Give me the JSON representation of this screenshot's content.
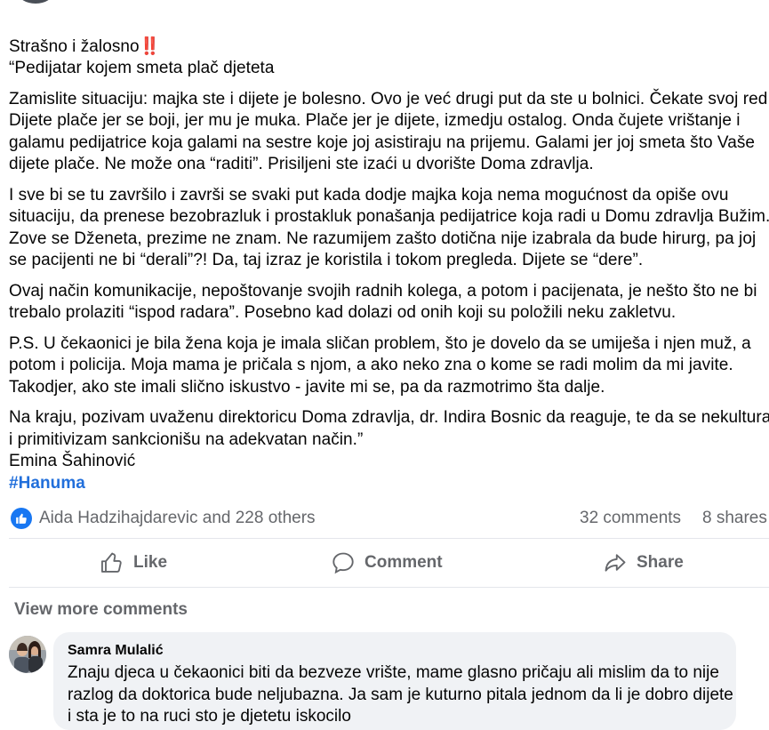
{
  "post": {
    "title_line1": "Strašno i žalosno",
    "title_emoji": "‼️",
    "title_line2": "“Pedijatar kojem smeta plač djeteta",
    "paragraphs": [
      "Zamislite situaciju: majka ste i dijete je bolesno. Ovo je već drugi put da ste u bolnici. Čekate svoj red. Dijete plače jer se boji, jer mu je muka. Plače jer je dijete, izmedju ostalog. Onda čujete vrištanje i galamu pedijatrice koja galami na sestre koje joj asistiraju na prijemu. Galami jer joj smeta što Vaše dijete plače. Ne može ona “raditi”. Prisiljeni ste izaći u dvorište Doma zdravlja.",
      "I sve bi se tu završilo i završi se svaki put kada dodje majka koja nema mogućnost da opiše ovu situaciju, da prenese bezobrazluk i prostakluk ponašanja pedijatrice koja radi u Domu zdravlja Bužim. Zove se Dženeta, prezime ne znam. Ne razumijem zašto dotična nije izabrala da bude hirurg, pa joj se pacijenti ne bi “derali”?! Da, taj izraz je koristila i tokom pregleda. Dijete se “dere”.",
      "Ovaj način komunikacije, nepoštovanje svojih radnih kolega, a potom i pacijenata, je nešto što ne bi trebalo prolaziti “ispod radara”. Posebno kad dolazi od onih koji su položili neku zakletvu.",
      "P.S. U čekaonici je bila žena koja je imala sličan problem, što je dovelo da se umiješa i njen muž, a potom i policija. Moja mama je pričala s njom, a ako neko zna o kome se radi molim da mi javite. Takodjer, ako ste imali slično iskustvo - javite mi se, pa da razmotrimo šta dalje.",
      "Na kraju, pozivam uvaženu direktoricu Doma zdravlja, dr. Indira Bosnic da reaguje, te da se nekultura i primitivizam sankcionišu na adekvatan način.”"
    ],
    "signature": "Emina Šahinović",
    "hashtag": "#Hanuma"
  },
  "reactions": {
    "icon": "like-icon",
    "reactors": "Aida Hadzihajdarevic and 228 others",
    "comments": "32 comments",
    "shares": "8 shares"
  },
  "actions": {
    "like": "Like",
    "comment": "Comment",
    "share": "Share"
  },
  "comments_section": {
    "view_more": "View more comments",
    "comment": {
      "author": "Samra Mulalić",
      "text": "Znaju djeca u čekaonici biti da bezveze vrište, mame glasno pričaju ali mislim da to nije razlog da doktorica bude neljubazna. Ja sam je kuturno pitala jednom da li je dobro dijete i sta je to na ruci sto je djetetu iskocilo"
    }
  },
  "colors": {
    "accent": "#1877f2",
    "hashtag": "#216fdb",
    "secondary_text": "#65676b"
  }
}
